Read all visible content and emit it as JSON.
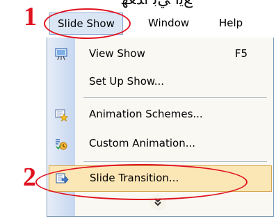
{
  "annotations": {
    "top_fragment": "ﻊﻳﺍ ﻲﺑ ﺍﺪﻌﻬ",
    "step1": "1",
    "step2": "2"
  },
  "menubar": {
    "items": [
      {
        "label": "Slide Show"
      },
      {
        "label": "Window"
      },
      {
        "label": "Help"
      }
    ]
  },
  "slide_show_menu": {
    "items": [
      {
        "label": "View Show",
        "shortcut": "F5",
        "icon": "view-show-icon"
      },
      {
        "label": "Set Up Show...",
        "shortcut": "",
        "icon": ""
      },
      {
        "label": "Animation Schemes...",
        "shortcut": "",
        "icon": "animation-schemes-icon"
      },
      {
        "label": "Custom Animation...",
        "shortcut": "",
        "icon": "custom-animation-icon"
      },
      {
        "label": "Slide Transition...",
        "shortcut": "",
        "icon": "slide-transition-icon"
      }
    ],
    "expand_icon": "chevron-double-down-icon"
  },
  "colors": {
    "callout_red": "#e0121e",
    "highlight_fill": "#fbe6b6",
    "highlight_border": "#d9a64f",
    "menubar_active": "#dbe6f5"
  }
}
